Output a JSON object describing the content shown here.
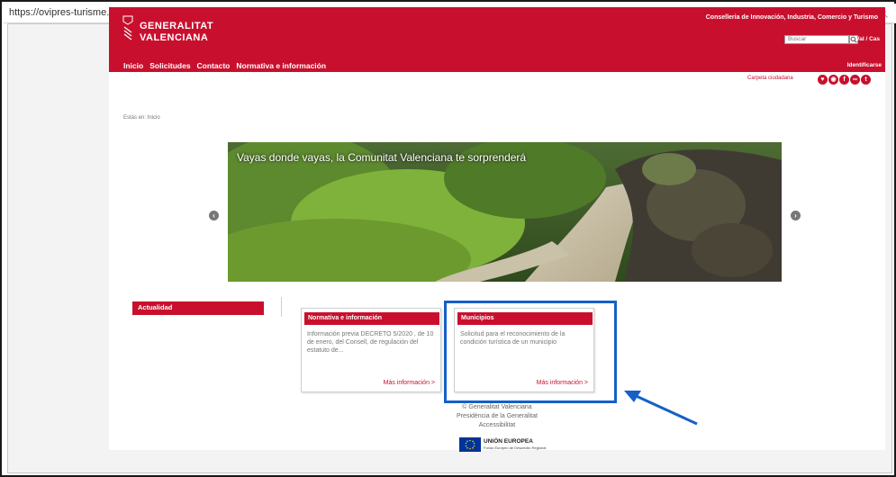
{
  "browser": {
    "url": "https://ovipres-turisme.gva.es/oficina_tactica/?idioma=es_ES#/inicio",
    "zoom_icon": "zoom-icon"
  },
  "header": {
    "logo_line1": "GENERALITAT",
    "logo_line2": "VALENCIANA",
    "conselleria": "Conselleria de Innovación, Industria, Comercio y Turismo",
    "search_placeholder": "Buscar",
    "lang": "Val / Cas",
    "identify": "Identificarse",
    "nav": [
      "Inicio",
      "Solicitudes",
      "Contacto",
      "Normativa e información"
    ]
  },
  "toolbar": {
    "carpeta": "Carpeta ciudadana"
  },
  "breadcrumb": "Estás en: Inicio",
  "hero": {
    "caption": "Vayas donde vayas, la Comunitat Valenciana te sorprenderá"
  },
  "actualidad": "Actualidad",
  "cards": [
    {
      "title": "Normativa e información",
      "body": "Información previa DECRETO 5/2020 , de 10 de enero, del Consell, de regulación del estatuto de...",
      "more": "Más información >"
    },
    {
      "title": "Municipios",
      "body": "Solicitud para el reconocimiento de la condición turística de un municipio",
      "more": "Más información >"
    }
  ],
  "footer": {
    "line1": "© Generalitat Valenciana",
    "line2": "Presidència de la Generalitat",
    "line3": "Accessibilitat",
    "eu_name": "UNIÓN EUROPEA",
    "eu_sub": "Fondo Europeo de Desarrollo Regional"
  },
  "colors": {
    "brand_red": "#c8102e",
    "annotation_blue": "#1560c8"
  }
}
